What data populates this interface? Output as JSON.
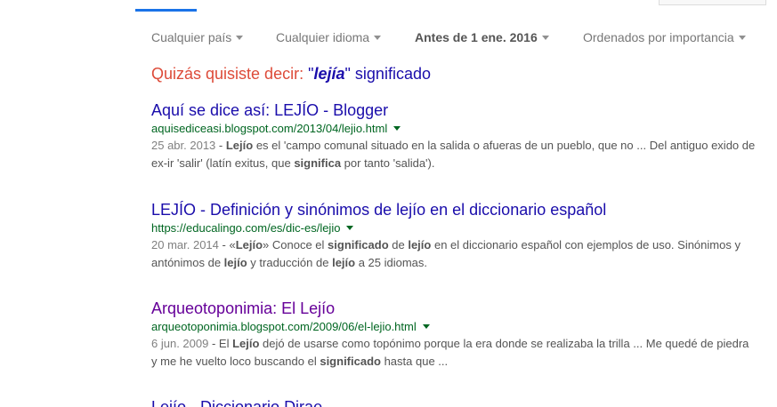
{
  "colors": {
    "link": "#1a0dab",
    "visited_link": "#660099",
    "url_green": "#006621",
    "snippet": "#545454",
    "spell_red": "#dd4b39",
    "tab_blue": "#1a73e8"
  },
  "tools": {
    "country": "Cualquier país",
    "language": "Cualquier idioma",
    "date": "Antes de 1 ene. 2016",
    "sort": "Ordenados por importancia"
  },
  "spell": {
    "lead": "Quizás quisiste decir:",
    "open_quote": "\"",
    "corrected_word": "lejía",
    "close_quote": "\"",
    "rest": "significado"
  },
  "results": [
    {
      "title": "Aquí se dice así: LEJÍO - Blogger",
      "url": "aquisediceasi.blogspot.com/2013/04/lejio.html",
      "date": "25 abr. 2013",
      "snippet_parts": [
        " - ",
        "Lejío",
        " es el 'campo comunal situado en la salida o afueras de un pueblo, que no ... Del antiguo exido de ex-ir 'salir' (latín exitus, que ",
        "significa",
        " por tanto 'salida')."
      ]
    },
    {
      "title": "LEJÍO - Definición y sinónimos de lejío en el diccionario español",
      "url": "https://educalingo.com/es/dic-es/lejio",
      "date": "20 mar. 2014",
      "snippet_parts": [
        " - «",
        "Lejío",
        "» Conoce el ",
        "significado",
        " de ",
        "lejío",
        " en el diccionario español con ejemplos de uso. Sinónimos y antónimos de ",
        "lejío",
        " y traducción de ",
        "lejío",
        " a 25 idiomas."
      ]
    },
    {
      "title": "Arqueotoponimia: El Lejío",
      "url": "arqueotoponimia.blogspot.com/2009/06/el-lejio.html",
      "date": "6 jun. 2009",
      "snippet_parts": [
        " - El ",
        "Lejío",
        " dejó de usarse como topónimo porque la era donde se realizaba la trilla ... Me quedé de piedra y me he vuelto loco buscando el ",
        "significado",
        " hasta que ..."
      ]
    }
  ],
  "partial_result": {
    "title": "Lejío - Diccionario Dirae"
  }
}
